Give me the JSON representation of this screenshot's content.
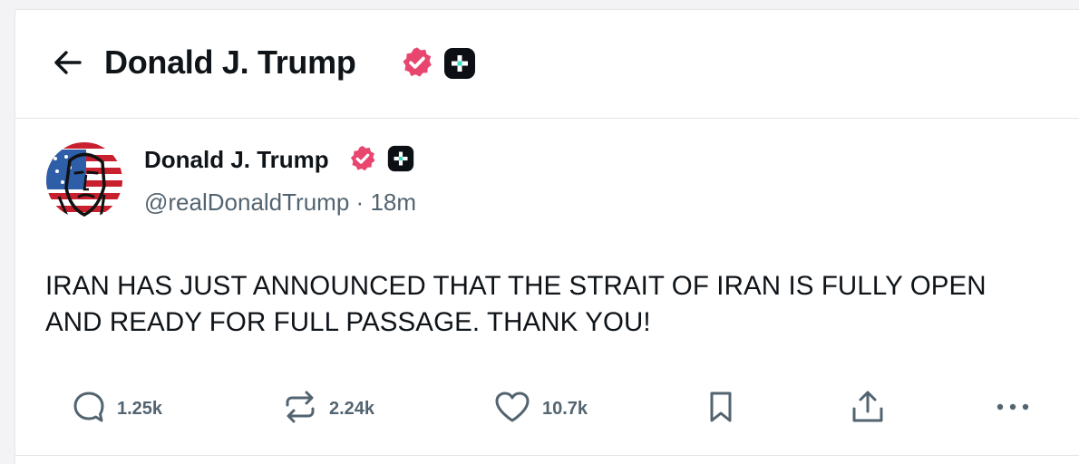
{
  "header": {
    "title": "Donald J. Trump",
    "back_icon": "arrow-left-icon",
    "verified_icon": "verified-badge-icon",
    "plus_icon": "plus-badge-icon"
  },
  "post": {
    "author_name": "Donald J. Trump",
    "handle": "@realDonaldTrump",
    "separator": "·",
    "time": "18m",
    "text": "IRAN HAS JUST ANNOUNCED THAT THE STRAIT OF IRAN IS FULLY OPEN AND READY FOR FULL PASSAGE. THANK YOU!"
  },
  "actions": {
    "reply_count": "1.25k",
    "repost_count": "2.24k",
    "like_count": "10.7k",
    "icons": [
      "reply-icon",
      "repost-icon",
      "like-icon",
      "bookmark-icon",
      "share-icon",
      "more-icon"
    ]
  },
  "colors": {
    "verified": "#e8466f",
    "text": "#0f1419",
    "muted": "#536471"
  }
}
